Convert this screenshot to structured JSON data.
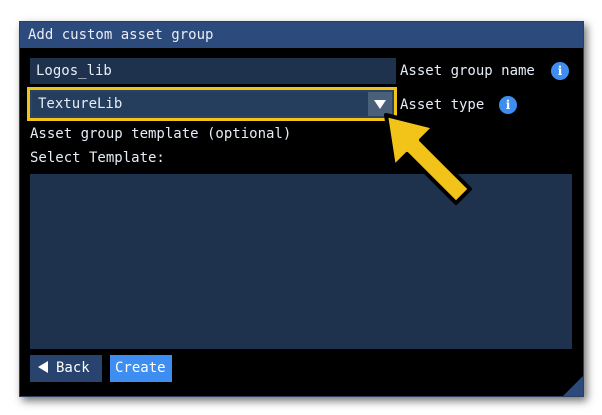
{
  "dialog": {
    "title": "Add custom asset group",
    "name_field": {
      "value": "Logos_lib"
    },
    "name_label": "Asset group name",
    "type_select": {
      "value": "TextureLib"
    },
    "type_label": "Asset type",
    "template_heading": "Asset group template (optional)",
    "template_label": "Select Template:",
    "back_label": "Back",
    "create_label": "Create"
  },
  "icons": {
    "info": "info-icon",
    "dropdown": "chevron-down-icon",
    "back": "triangle-left-icon",
    "pointer": "arrow-pointer-icon"
  },
  "colors": {
    "titlebar": "#2c4a7c",
    "field": "#1e324e",
    "accent": "#3d8ef0",
    "highlight": "#f2c318"
  }
}
